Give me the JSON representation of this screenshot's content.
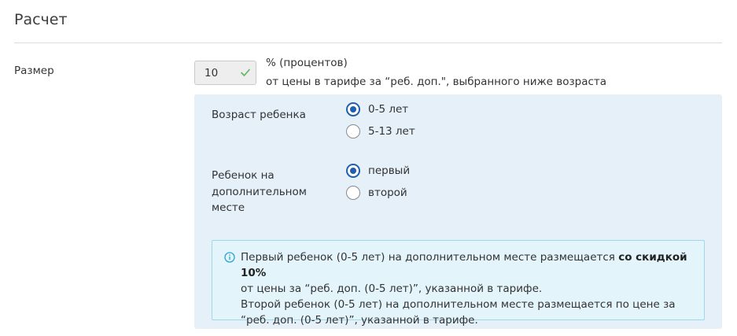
{
  "section": {
    "title": "Расчет"
  },
  "size_field": {
    "label": "Размер",
    "value": "10",
    "unit": "% (процентов)",
    "description": "от цены в тарифе за “реб. доп.\", выбранного ниже возраста"
  },
  "age_group": {
    "label": "Возраст ребенка",
    "options": [
      {
        "label": "0-5 лет",
        "selected": true
      },
      {
        "label": "5-13 лет",
        "selected": false
      }
    ]
  },
  "extra_place_group": {
    "label_lines": [
      "Ребенок на",
      "дополнительном",
      "месте"
    ],
    "options": [
      {
        "label": "первый",
        "selected": true
      },
      {
        "label": "второй",
        "selected": false
      }
    ]
  },
  "info": {
    "line1_prefix": "Первый ребенок (0-5 лет) на дополнительном месте размещается ",
    "line1_bold": "со скидкой 10%",
    "line2": "от цены за “реб. доп. (0-5 лет)”, указанной в тарифе.",
    "line3": "Второй ребенок (0-5 лет) на дополнительном месте размещается по цене за “реб. доп. (0-5 лет)”, указанной в тарифе."
  },
  "colors": {
    "accent": "#1f5fae",
    "panel_bg": "#e5f0f9",
    "info_bg": "#e3f4fb",
    "info_border": "#9fd7ee",
    "check": "#5cb85c"
  },
  "icons": {
    "input_valid": "check-icon",
    "info": "info-icon"
  }
}
